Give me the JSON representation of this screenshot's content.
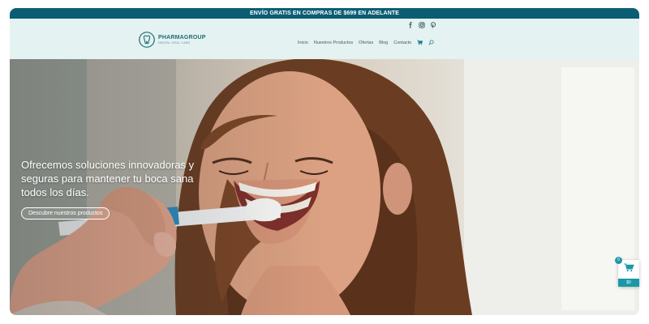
{
  "promo_bar": {
    "text": "ENVÍO GRATIS EN COMPRAS DE $699 EN ADELANTE"
  },
  "social": {
    "icons": [
      "facebook-icon",
      "instagram-icon",
      "pinterest-icon"
    ]
  },
  "brand": {
    "name": "PHARMAGROUP",
    "tagline": "DENTAL ORAL CARE"
  },
  "nav": {
    "items": [
      "Inicio",
      "Nuestros Productos",
      "Ofertas",
      "Blog",
      "Contacto"
    ],
    "icons": [
      "cart-icon",
      "search-icon"
    ]
  },
  "hero": {
    "heading": "Ofrecemos soluciones innovadoras y seguras para mantener tu boca sana todos los días.",
    "cta_label": "Descubre nuestros productos"
  },
  "cart_widget": {
    "count": "0",
    "total": "$0"
  },
  "colors": {
    "promo_bar_bg": "#0b5d73",
    "header_bg": "#e4f2f1",
    "brand_teal": "#1f6b74",
    "accent": "#1b98a8"
  }
}
